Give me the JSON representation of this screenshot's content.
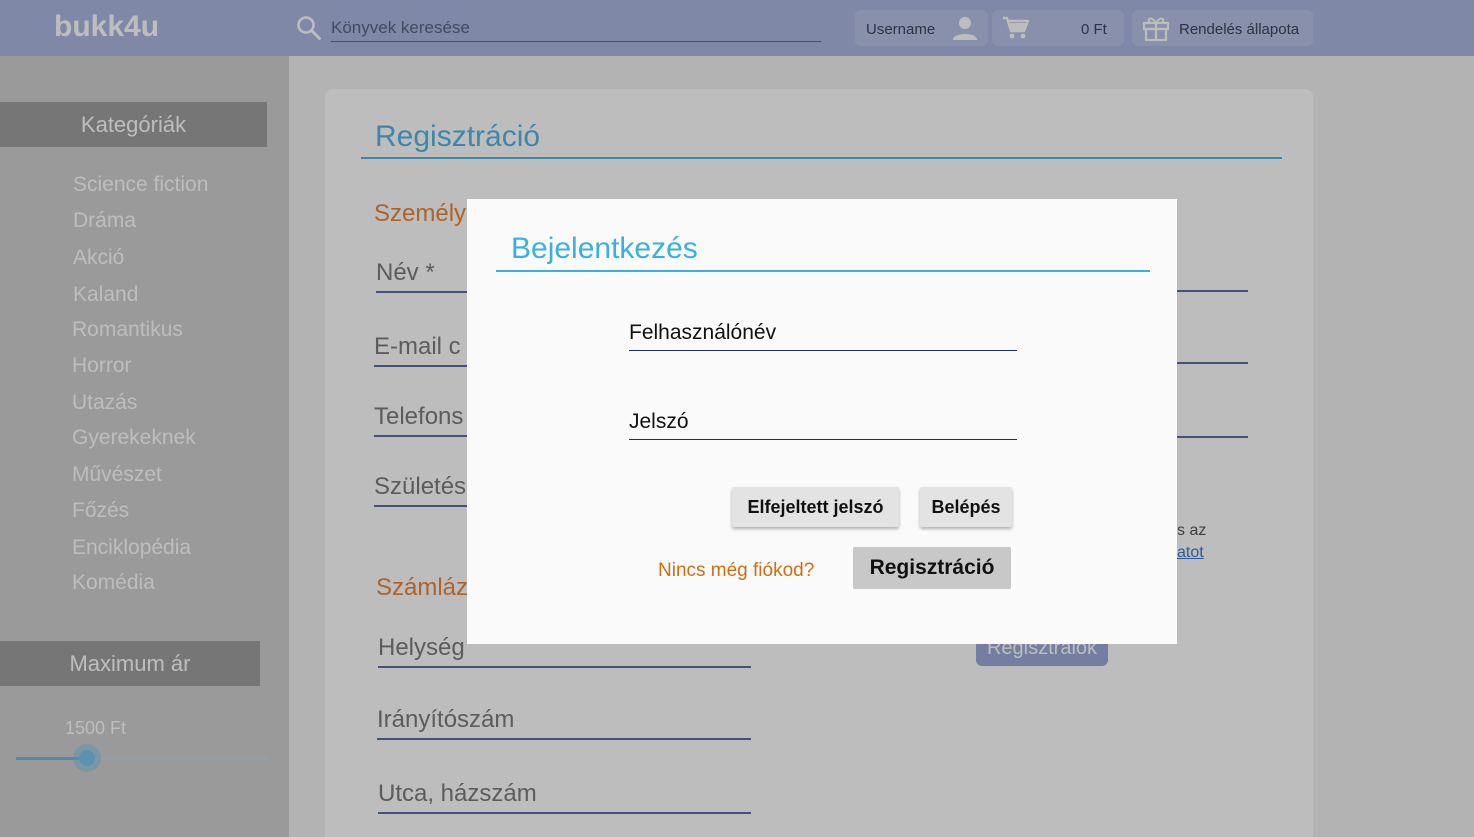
{
  "header": {
    "logo": "bukk4u",
    "search_placeholder": "Könyvek keresése",
    "username": "Username",
    "cart_total": "0 Ft",
    "order_status": "Rendelés állapota"
  },
  "sidebar": {
    "categories_title": "Kategóriák",
    "categories": [
      "Science fiction",
      "Dráma",
      "Akció",
      "Kaland",
      "Romantikus",
      "Horror",
      "Utazás",
      "Gyerekeknek",
      "Művészet",
      "Főzés",
      "Enciklopédia",
      "Komédia"
    ],
    "max_price_title": "Maximum ár",
    "max_price_value": "1500 Ft",
    "max_price_fraction": 0.28
  },
  "registration": {
    "title": "Regisztráció",
    "personal_section": "Személy",
    "fields_visible": [
      "Név *",
      "E-mail c",
      "Telefons",
      "Születés"
    ],
    "billing_section": "Számláz",
    "billing_fields": [
      "Helység",
      "Irányítószám",
      "Utca, házszám"
    ],
    "terms_fragment": "s az",
    "terms_link_fragment": "atot",
    "submit_label": "Regisztrálok"
  },
  "login_modal": {
    "title": "Bejelentkezés",
    "username_field": "Felhasználónév",
    "password_field": "Jelszó",
    "forgot_password": "Elfejeltett jelszó",
    "login_button": "Belépés",
    "no_account_text": "Nincs még fiókod?",
    "register_button": "Regisztráció"
  },
  "colors": {
    "header_bg": "#acb8e0",
    "accent_blue": "#3ab0e0",
    "section_orange": "#e8873a",
    "field_line": "#1f2d6b"
  }
}
